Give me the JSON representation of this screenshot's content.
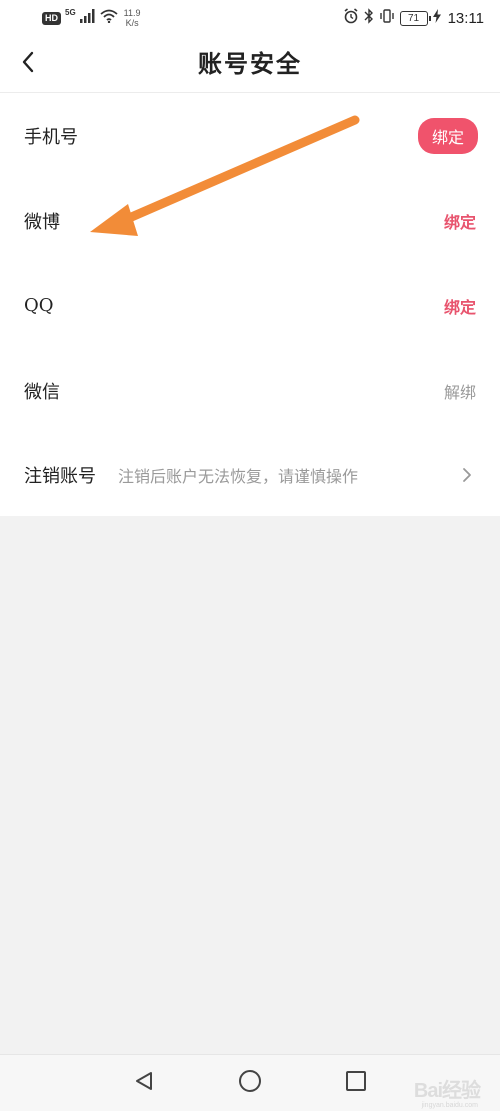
{
  "status_bar": {
    "hd": "HD",
    "network": "5G",
    "speed_value": "11.9",
    "speed_unit": "K/s",
    "battery": "71",
    "time": "13:11"
  },
  "header": {
    "title": "账号安全"
  },
  "rows": [
    {
      "label": "手机号",
      "action": "绑定"
    },
    {
      "label": "微博",
      "action": "绑定"
    },
    {
      "label": "QQ",
      "action": "绑定"
    },
    {
      "label": "微信",
      "action": "解绑"
    },
    {
      "label": "注销账号",
      "hint": "注销后账户无法恢复，请谨慎操作"
    }
  ],
  "colors": {
    "accent": "#e8546e",
    "pill_bg": "#f0536c",
    "annotation_arrow": "#f28c38"
  },
  "icons": {
    "back": "chevron-left-icon",
    "chevron": "chevron-right-icon",
    "nav_back": "triangle-back-icon",
    "nav_home": "circle-home-icon",
    "nav_recent": "square-recent-icon"
  },
  "watermark": {
    "text": "Bai经验",
    "sub": "jingyan.baidu.com"
  }
}
